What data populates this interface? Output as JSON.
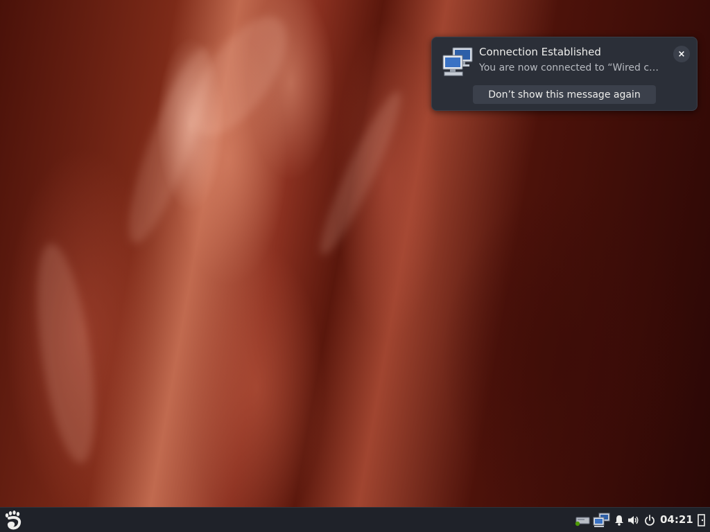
{
  "notification": {
    "title": "Connection Established",
    "body": "You are now connected to “Wired c…",
    "action_label": "Don’t show this message again",
    "close_glyph": "×",
    "icon": "network-computers-icon"
  },
  "panel": {
    "activities_icon": "gnome-foot-icon",
    "tray_icons": [
      "removable-drive-icon",
      "network-wired-icon",
      "notifications-bell-icon",
      "volume-icon",
      "power-icon",
      "logout-icon"
    ],
    "clock": "04:21"
  },
  "colors": {
    "panel_bg": "#1f2229",
    "notification_bg": "#2b2f38",
    "button_bg": "#3b404b",
    "text_primary": "#eeeeec"
  }
}
